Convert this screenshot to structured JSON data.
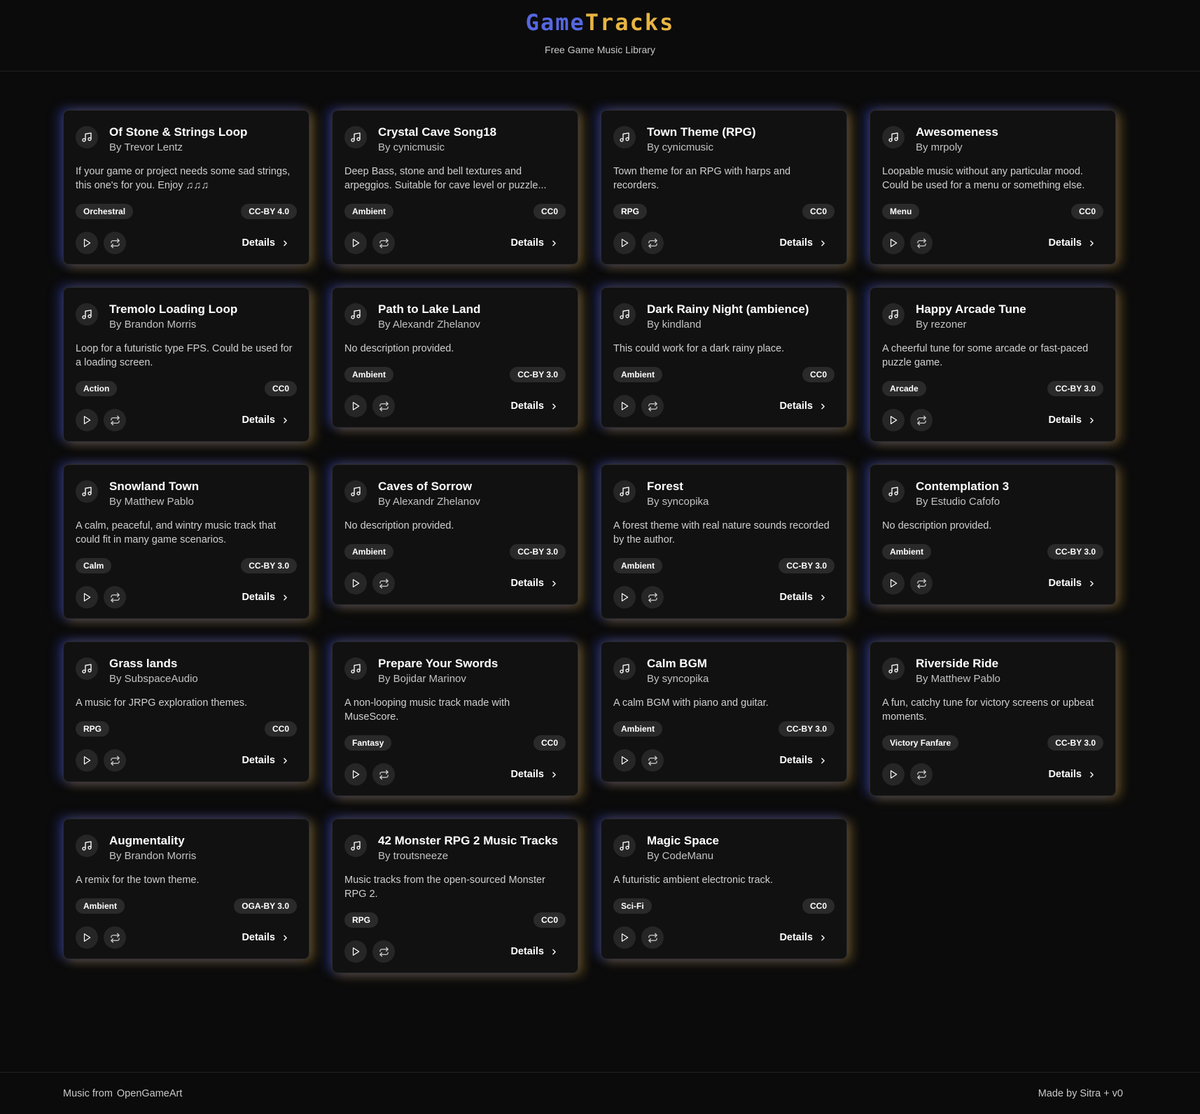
{
  "header": {
    "brand_part1": "Game",
    "brand_part2": "Tracks",
    "tagline": "Free Game Music Library"
  },
  "details_label": "Details",
  "colors": {
    "brand_blue": "#5667e0",
    "brand_gold": "#e8b542",
    "glow_blue": "#4056ff",
    "glow_gold": "#e8b23c",
    "background": "#0b0b0b",
    "card": "#111111"
  },
  "icons": {
    "card_icon": "music-note-icon",
    "play": "play-icon",
    "loop": "repeat-icon",
    "details": "chevron-right-icon"
  },
  "tracks": [
    {
      "title": "Of Stone & Strings Loop",
      "author": "By Trevor Lentz",
      "description": "If your game or project needs some sad strings, this one's for you. Enjoy ♫♫♫",
      "genre": "Orchestral",
      "license": "CC-BY 4.0"
    },
    {
      "title": "Crystal Cave Song18",
      "author": "By cynicmusic",
      "description": "Deep Bass, stone and bell textures and arpeggios. Suitable for cave level or puzzle...",
      "genre": "Ambient",
      "license": "CC0"
    },
    {
      "title": "Town Theme (RPG)",
      "author": "By cynicmusic",
      "description": "Town theme for an RPG with harps and recorders.",
      "genre": "RPG",
      "license": "CC0"
    },
    {
      "title": "Awesomeness",
      "author": "By mrpoly",
      "description": "Loopable music without any particular mood. Could be used for a menu or something else.",
      "genre": "Menu",
      "license": "CC0"
    },
    {
      "title": "Tremolo Loading Loop",
      "author": "By Brandon Morris",
      "description": "Loop for a futuristic type FPS. Could be used for a loading screen.",
      "genre": "Action",
      "license": "CC0"
    },
    {
      "title": "Path to Lake Land",
      "author": "By Alexandr Zhelanov",
      "description": "No description provided.",
      "genre": "Ambient",
      "license": "CC-BY 3.0"
    },
    {
      "title": "Dark Rainy Night (ambience)",
      "author": "By kindland",
      "description": "This could work for a dark rainy place.",
      "genre": "Ambient",
      "license": "CC0"
    },
    {
      "title": "Happy Arcade Tune",
      "author": "By rezoner",
      "description": "A cheerful tune for some arcade or fast-paced puzzle game.",
      "genre": "Arcade",
      "license": "CC-BY 3.0"
    },
    {
      "title": "Snowland Town",
      "author": "By Matthew Pablo",
      "description": "A calm, peaceful, and wintry music track that could fit in many game scenarios.",
      "genre": "Calm",
      "license": "CC-BY 3.0"
    },
    {
      "title": "Caves of Sorrow",
      "author": "By Alexandr Zhelanov",
      "description": "No description provided.",
      "genre": "Ambient",
      "license": "CC-BY 3.0"
    },
    {
      "title": "Forest",
      "author": "By syncopika",
      "description": "A forest theme with real nature sounds recorded by the author.",
      "genre": "Ambient",
      "license": "CC-BY 3.0"
    },
    {
      "title": "Contemplation 3",
      "author": "By Estudio Cafofo",
      "description": "No description provided.",
      "genre": "Ambient",
      "license": "CC-BY 3.0"
    },
    {
      "title": "Grass lands",
      "author": "By SubspaceAudio",
      "description": "A music for JRPG exploration themes.",
      "genre": "RPG",
      "license": "CC0"
    },
    {
      "title": "Prepare Your Swords",
      "author": "By Bojidar Marinov",
      "description": "A non-looping music track made with MuseScore.",
      "genre": "Fantasy",
      "license": "CC0"
    },
    {
      "title": "Calm BGM",
      "author": "By syncopika",
      "description": "A calm BGM with piano and guitar.",
      "genre": "Ambient",
      "license": "CC-BY 3.0"
    },
    {
      "title": "Riverside Ride",
      "author": "By Matthew Pablo",
      "description": "A fun, catchy tune for victory screens or upbeat moments.",
      "genre": "Victory Fanfare",
      "license": "CC-BY 3.0"
    },
    {
      "title": "Augmentality",
      "author": "By Brandon Morris",
      "description": "A remix for the town theme.",
      "genre": "Ambient",
      "license": "OGA-BY 3.0"
    },
    {
      "title": "42 Monster RPG 2 Music Tracks",
      "author": "By troutsneeze",
      "description": "Music tracks from the open-sourced Monster RPG 2.",
      "genre": "RPG",
      "license": "CC0"
    },
    {
      "title": "Magic Space",
      "author": "By CodeManu",
      "description": "A futuristic ambient electronic track.",
      "genre": "Sci-Fi",
      "license": "CC0"
    }
  ],
  "footer": {
    "music_from_label": "Music from",
    "source_link": "OpenGameArt",
    "credit": "Made by Sitra + v0"
  }
}
